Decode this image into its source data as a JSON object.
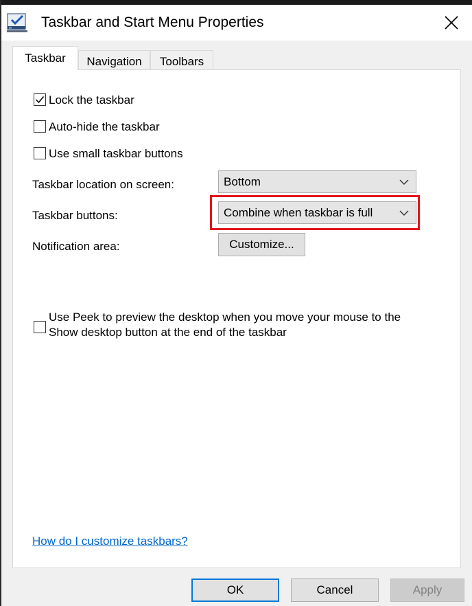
{
  "window": {
    "title": "Taskbar and Start Menu Properties",
    "icon": "taskbar-properties-icon",
    "close_icon": "close-icon"
  },
  "tabs": [
    {
      "label": "Taskbar",
      "active": true
    },
    {
      "label": "Navigation",
      "active": false
    },
    {
      "label": "Toolbars",
      "active": false
    }
  ],
  "checkboxes": {
    "lock": {
      "label": "Lock the taskbar",
      "checked": true
    },
    "autohide": {
      "label": "Auto-hide the taskbar",
      "checked": false
    },
    "small_buttons": {
      "label": "Use small taskbar buttons",
      "checked": false
    },
    "peek": {
      "line1": "Use Peek to preview the desktop when you move your mouse to the",
      "line2": "Show desktop button at the end of the taskbar",
      "checked": false
    }
  },
  "fields": {
    "location": {
      "label": "Taskbar location on screen:",
      "value": "Bottom"
    },
    "buttons": {
      "label": "Taskbar buttons:",
      "value": "Combine when taskbar is full"
    },
    "notification": {
      "label": "Notification area:",
      "button": "Customize..."
    }
  },
  "help_link": "How do I customize taskbars?",
  "footer": {
    "ok": "OK",
    "cancel": "Cancel",
    "apply": "Apply"
  },
  "colors": {
    "highlight": "#e3131b",
    "link": "#0066cc",
    "default_button_border": "#0078d7"
  }
}
